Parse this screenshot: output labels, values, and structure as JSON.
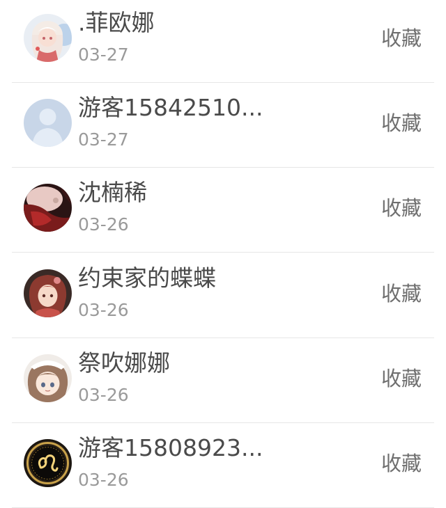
{
  "users": [
    {
      "name": ".菲欧娜",
      "date": "03-27",
      "action": "收藏",
      "avatar_icon": "anime-girl-avatar-icon"
    },
    {
      "name": "游客15842510...",
      "date": "03-27",
      "action": "收藏",
      "avatar_icon": "default-user-avatar-icon"
    },
    {
      "name": "沈楠稀",
      "date": "03-26",
      "action": "收藏",
      "avatar_icon": "dark-red-avatar-icon"
    },
    {
      "name": "约束家的蝶蝶",
      "date": "03-26",
      "action": "收藏",
      "avatar_icon": "red-haired-girl-avatar-icon"
    },
    {
      "name": "祭吹娜娜",
      "date": "03-26",
      "action": "收藏",
      "avatar_icon": "maid-girl-avatar-icon"
    },
    {
      "name": "游客15808923...",
      "date": "03-26",
      "action": "收藏",
      "avatar_icon": "leo-zodiac-avatar-icon"
    }
  ],
  "colors": {
    "name_text": "#4a4a4a",
    "date_text": "#9a9a9a",
    "action_text": "#6f6f6f",
    "divider": "#e6e6e6"
  }
}
